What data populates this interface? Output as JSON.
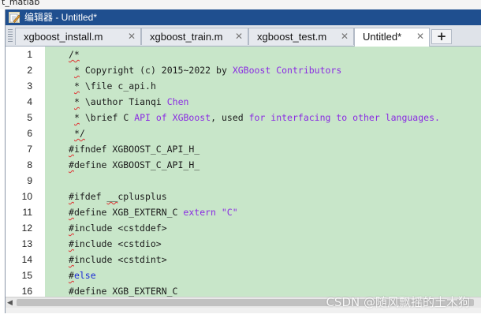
{
  "top_strip": {
    "text": "t_matlab"
  },
  "window": {
    "title": "编辑器 - Untitled*"
  },
  "tabs": [
    {
      "label": "xgboost_install.m",
      "close": "✕",
      "active": false
    },
    {
      "label": "xgboost_train.m",
      "close": "✕",
      "active": false
    },
    {
      "label": "xgboost_test.m",
      "close": "✕",
      "active": false
    },
    {
      "label": "Untitled*",
      "close": "✕",
      "active": true
    }
  ],
  "add_tab_label": "+",
  "editor": {
    "lines": [
      {
        "num": "1",
        "segments": [
          {
            "text": "/*",
            "style": "squig"
          }
        ],
        "indent": 0
      },
      {
        "num": "2",
        "segments": [
          {
            "text": "*",
            "style": "squig"
          },
          {
            "text": " Copyright (c) 2015~2022 by ",
            "style": "black"
          },
          {
            "text": "XGBoost Contributors",
            "style": "purple"
          }
        ],
        "indent": 1
      },
      {
        "num": "3",
        "segments": [
          {
            "text": "*",
            "style": "squig"
          },
          {
            "text": " \\file c_api.h",
            "style": "black"
          }
        ],
        "indent": 1
      },
      {
        "num": "4",
        "segments": [
          {
            "text": "*",
            "style": "squig"
          },
          {
            "text": " \\author Tianqi ",
            "style": "black"
          },
          {
            "text": "Chen",
            "style": "purple"
          }
        ],
        "indent": 1
      },
      {
        "num": "5",
        "segments": [
          {
            "text": "*",
            "style": "squig"
          },
          {
            "text": " \\brief C ",
            "style": "black"
          },
          {
            "text": "API of XGBoost",
            "style": "purple"
          },
          {
            "text": ", used ",
            "style": "black"
          },
          {
            "text": "for interfacing to other languages.",
            "style": "purple"
          }
        ],
        "indent": 1
      },
      {
        "num": "6",
        "segments": [
          {
            "text": "*/",
            "style": "squig"
          }
        ],
        "indent": 1
      },
      {
        "num": "7",
        "segments": [
          {
            "text": "#",
            "style": "squig"
          },
          {
            "text": "ifndef XGBOOST_C_API_H_",
            "style": "black"
          }
        ],
        "indent": 0
      },
      {
        "num": "8",
        "segments": [
          {
            "text": "#",
            "style": "squig"
          },
          {
            "text": "define XGBOOST_C_API_H_",
            "style": "black"
          }
        ],
        "indent": 0
      },
      {
        "num": "9",
        "segments": [],
        "indent": 0
      },
      {
        "num": "10",
        "segments": [
          {
            "text": "#",
            "style": "squig"
          },
          {
            "text": "ifdef ",
            "style": "black"
          },
          {
            "text": "__",
            "style": "squig"
          },
          {
            "text": "cplusplus",
            "style": "black"
          }
        ],
        "indent": 0
      },
      {
        "num": "11",
        "segments": [
          {
            "text": "#",
            "style": "squig"
          },
          {
            "text": "define XGB_EXTERN_C ",
            "style": "black"
          },
          {
            "text": "extern \"C\"",
            "style": "purple"
          }
        ],
        "indent": 0
      },
      {
        "num": "12",
        "segments": [
          {
            "text": "#",
            "style": "squig"
          },
          {
            "text": "include <cstddef>",
            "style": "black"
          }
        ],
        "indent": 0
      },
      {
        "num": "13",
        "segments": [
          {
            "text": "#",
            "style": "squig"
          },
          {
            "text": "include <cstdio>",
            "style": "black"
          }
        ],
        "indent": 0
      },
      {
        "num": "14",
        "segments": [
          {
            "text": "#",
            "style": "squig"
          },
          {
            "text": "include <cstdint>",
            "style": "black"
          }
        ],
        "indent": 0
      },
      {
        "num": "15",
        "segments": [
          {
            "text": "#",
            "style": "squig"
          },
          {
            "text": "else",
            "style": "blue"
          }
        ],
        "indent": 0
      },
      {
        "num": "16",
        "segments": [
          {
            "text": "#",
            "style": "squig"
          },
          {
            "text": "define XGB_EXTERN_C",
            "style": "black"
          }
        ],
        "indent": 0
      }
    ]
  },
  "watermark": "CSDN @随风飘摇的土木狗",
  "colors": {
    "titlebar": "#1f4f8f",
    "code_background": "#c8e6c9",
    "keyword": "#1c2bd6",
    "string": "#8a2be2",
    "squiggle": "#e03030"
  },
  "icons": {
    "title": "editor-pencil-icon",
    "scroll_left": "arrow-left-icon"
  }
}
